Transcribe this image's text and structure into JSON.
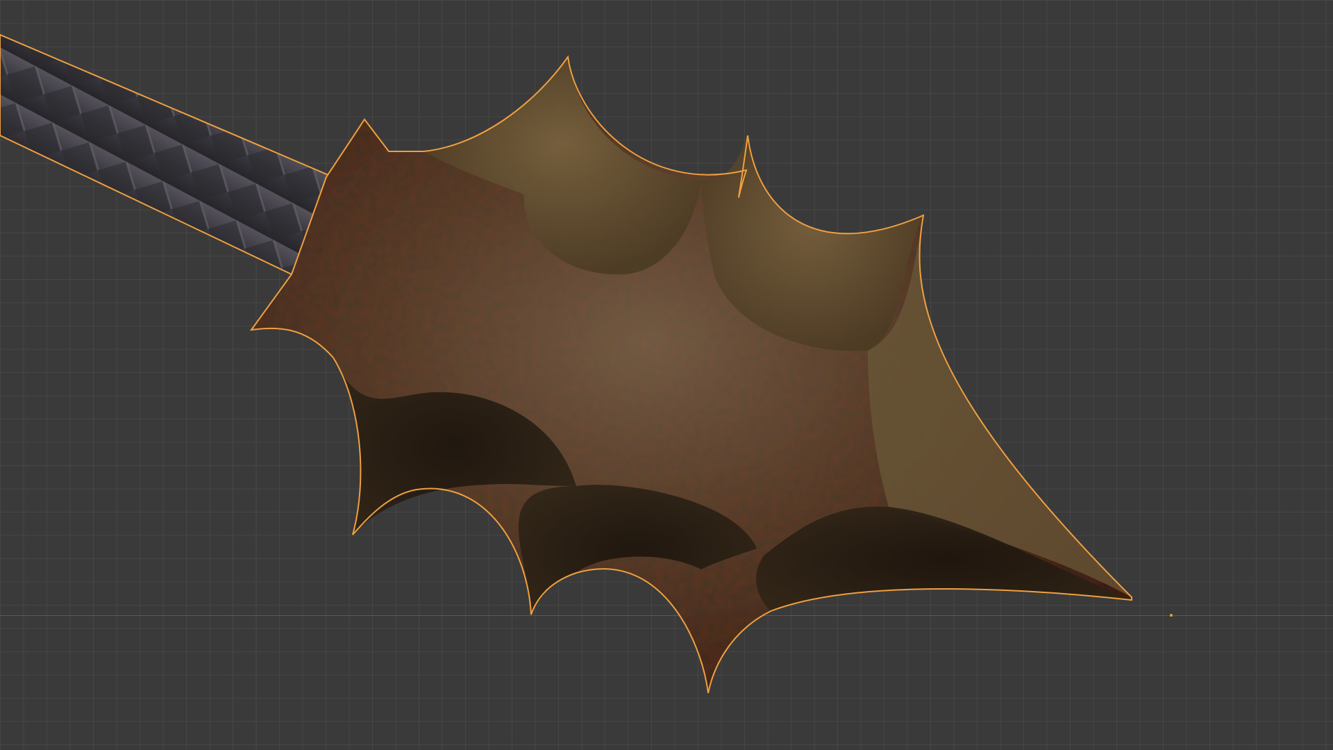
{
  "viewport": {
    "background_color": "#3a3a3a",
    "grid_color": "#505050",
    "x_axis_color": "#9a4848",
    "selection_outline_color": "#f0a040",
    "origin_color": "#e8a040"
  },
  "scene": {
    "object": "spear-head-with-wrapped-shaft",
    "selected": true,
    "blade_color": "#4a3a28",
    "shaft_color": "#3a3840"
  }
}
